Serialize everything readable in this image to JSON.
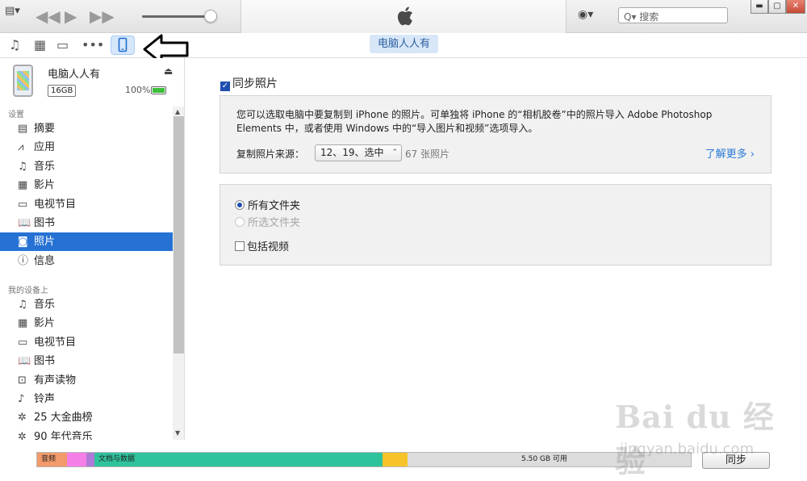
{
  "titlebar": {
    "menu_glyph": "▤▾",
    "search_placeholder": "搜索",
    "search_glyph": "Q▾",
    "account_glyph": "◉▾",
    "apple_logo": "apple-logo"
  },
  "toolbar": {
    "icons": [
      "music-icon",
      "film-icon",
      "tv-icon",
      "more-icon",
      "device-icon"
    ],
    "device_tab": "电脑人人有"
  },
  "device": {
    "name": "电脑人人有",
    "capacity": "16GB",
    "battery": "100%"
  },
  "sidebar": {
    "settings_heading": "设置",
    "settings_items": [
      {
        "label": "摘要",
        "icon": "summary-icon",
        "glyph": "▤"
      },
      {
        "label": "应用",
        "icon": "apps-icon",
        "glyph": "⩘"
      },
      {
        "label": "音乐",
        "icon": "music-icon",
        "glyph": "♫"
      },
      {
        "label": "影片",
        "icon": "film-icon",
        "glyph": "▦"
      },
      {
        "label": "电视节目",
        "icon": "tv-icon",
        "glyph": "▭"
      },
      {
        "label": "图书",
        "icon": "book-icon",
        "glyph": "📖"
      },
      {
        "label": "照片",
        "icon": "camera-icon",
        "glyph": "◙"
      },
      {
        "label": "信息",
        "icon": "info-icon",
        "glyph": "ⓘ"
      }
    ],
    "selected_index": 6,
    "device_heading": "我的设备上",
    "device_items": [
      {
        "label": "音乐",
        "icon": "music-icon",
        "glyph": "♫"
      },
      {
        "label": "影片",
        "icon": "film-icon",
        "glyph": "▦"
      },
      {
        "label": "电视节目",
        "icon": "tv-icon",
        "glyph": "▭"
      },
      {
        "label": "图书",
        "icon": "book-icon",
        "glyph": "📖"
      },
      {
        "label": "有声读物",
        "icon": "audiobook-icon",
        "glyph": "⊡"
      },
      {
        "label": "铃声",
        "icon": "bell-icon",
        "glyph": "♪"
      },
      {
        "label": "25 大金曲榜",
        "icon": "gear-icon",
        "glyph": "✲"
      },
      {
        "label": "90 年代音乐",
        "icon": "gear-icon",
        "glyph": "✲"
      }
    ]
  },
  "main": {
    "sync_label": "同步照片",
    "sync_checked": true,
    "description": "您可以选取电脑中要复制到 iPhone 的照片。可单独将 iPhone 的“相机胶卷”中的照片导入 Adobe Photoshop Elements 中，或者使用 Windows 中的“导入图片和视频”选项导入。",
    "source_label": "复制照片来源：",
    "source_value": "12、19、选中",
    "source_count": "67 张照片",
    "learn_more": "了解更多 ›",
    "options": {
      "all_folders": "所有文件夹",
      "selected_folders": "所选文件夹",
      "include_videos": "包括视频"
    }
  },
  "storage": {
    "audio_label": "音频",
    "docs_label": "文档与数据",
    "free_label": "5.50 GB 可用",
    "colors": {
      "audio": "#f29a6b",
      "photos": "#f47fe6",
      "apps": "#b07ad8",
      "docs": "#2fc39c",
      "other": "#f6c42a",
      "free": "#dcdcdc"
    }
  },
  "sync_button": "同步",
  "watermark": {
    "logo": "Bai du 经验",
    "url": "jingyan.baidu.com"
  }
}
